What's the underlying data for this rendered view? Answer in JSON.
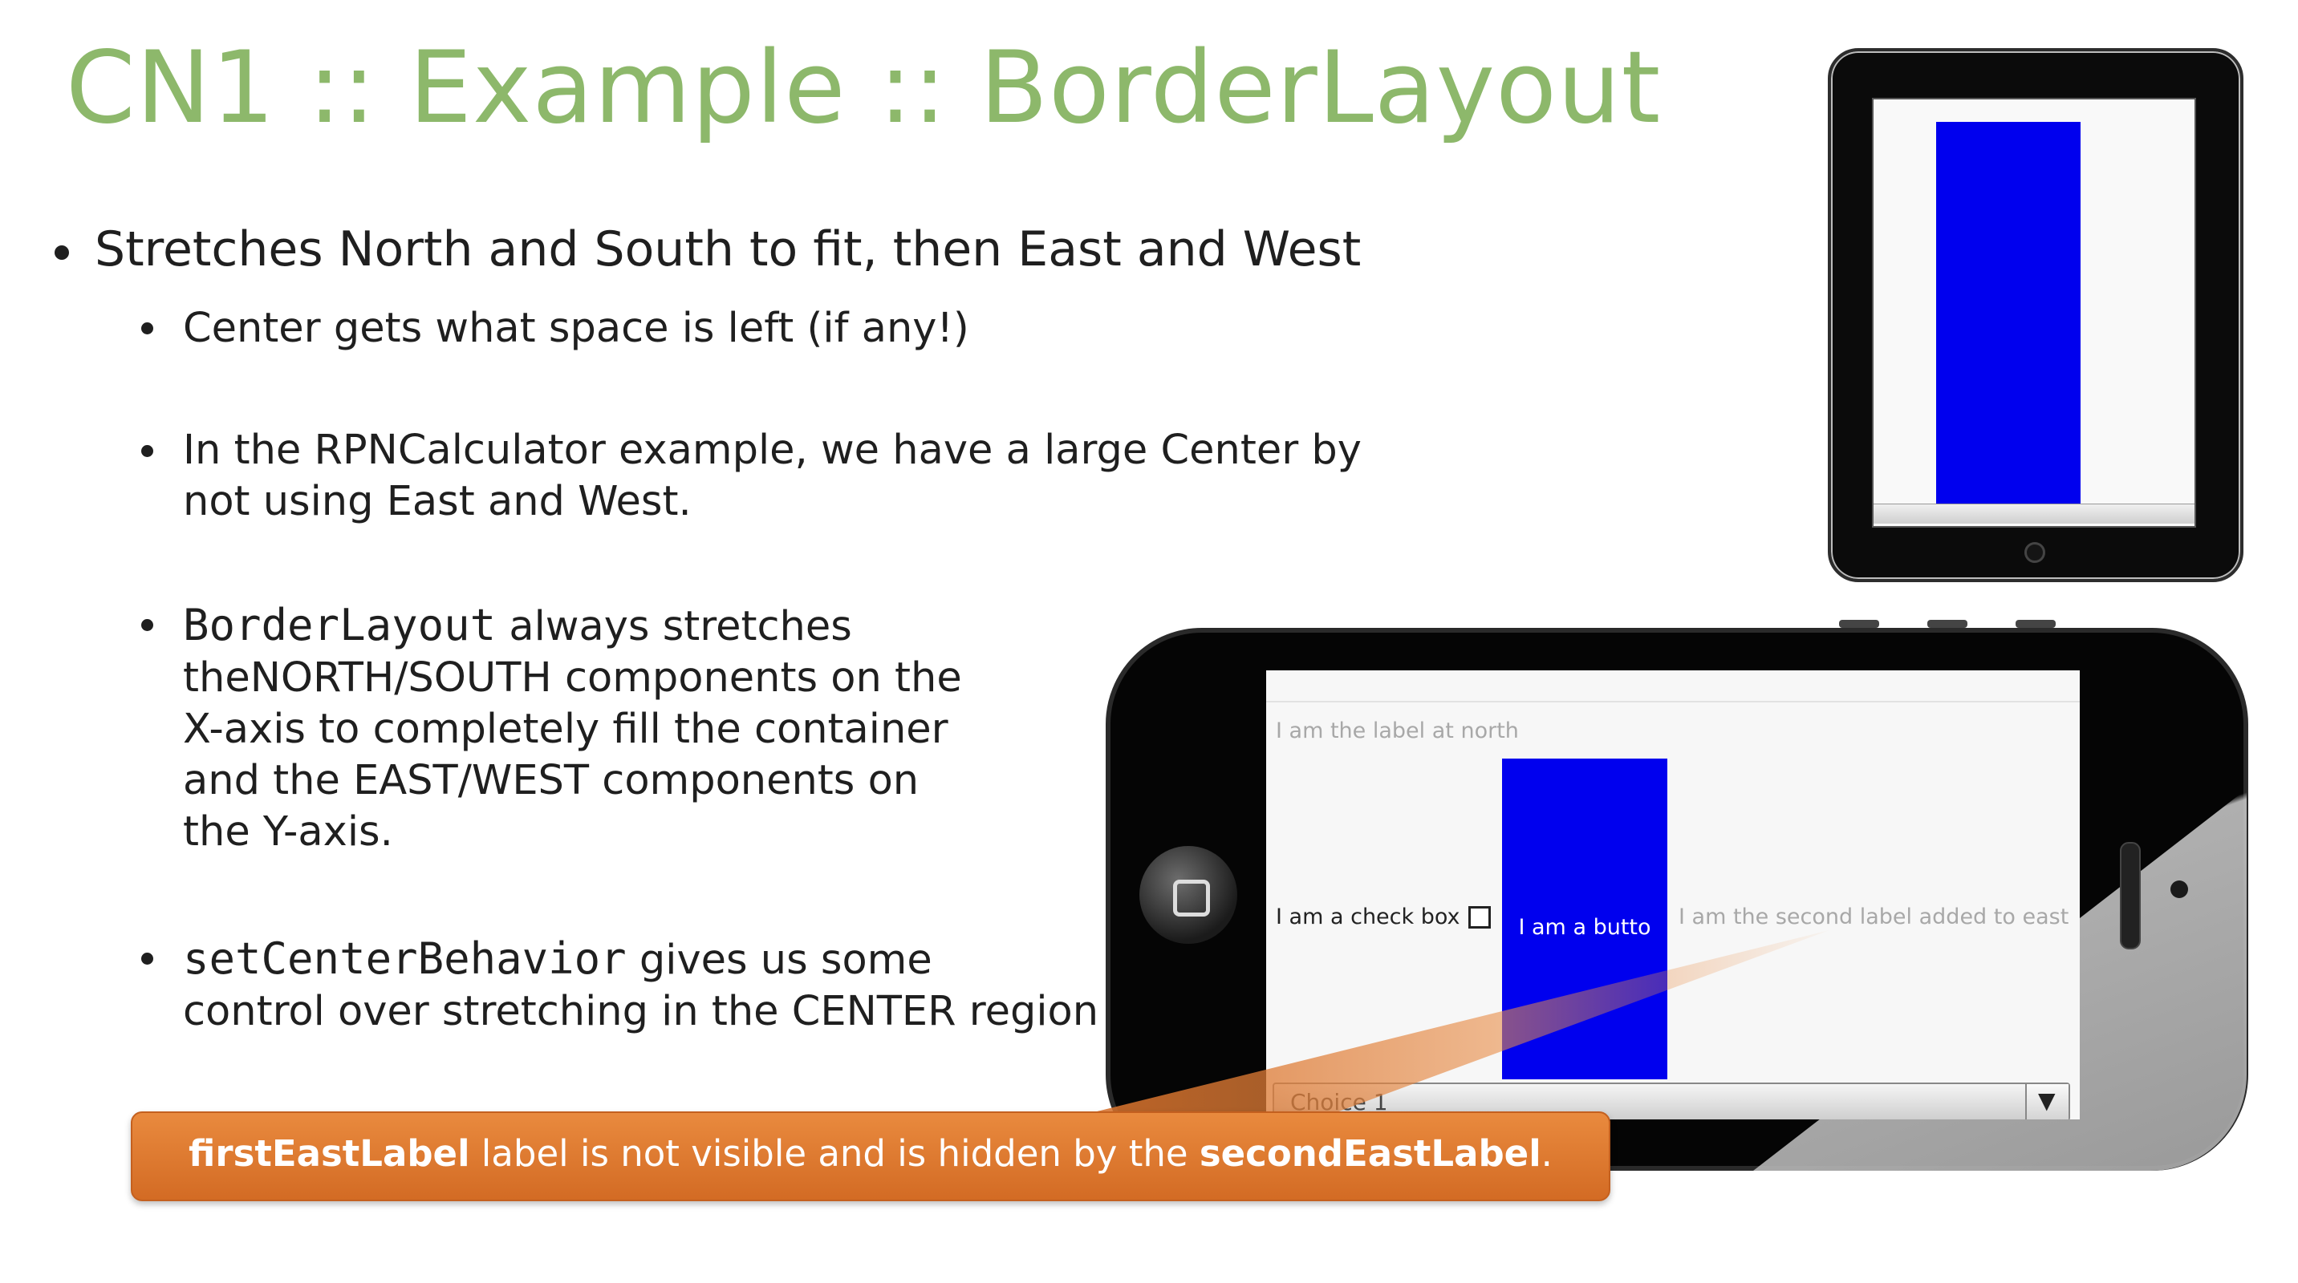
{
  "slide": {
    "title": "CN1 :: Example :: BorderLayout",
    "bullets": [
      {
        "text": "Stretches North and South to fit, then East and West"
      },
      {
        "text": "Center gets what space is left (if any!)"
      },
      {
        "line1": "In the RPNCalculator example, we have a large Center by",
        "line2": "not using East and West."
      },
      {
        "code": "BorderLayout",
        "line1_rest": " always stretches",
        "line2": "theNORTH/SOUTH components on  the",
        "line3": "X-axis to completely fill the container",
        "line4": "and the EAST/WEST components on",
        "line5": "the Y-axis."
      },
      {
        "code": "setCenterBehavior",
        "line1_rest": " gives us some",
        "line2": "control over stretching in the CENTER region"
      }
    ]
  },
  "phone_demo": {
    "north_label": "I am the label at north",
    "west_checkbox_label": "I am a check box",
    "checkbox_checked": false,
    "center_button_label": "I am a butto",
    "east_label": "I am the second label added to east",
    "south_combo_value": "Choice 1",
    "button_color": "#0000ee"
  },
  "callout": {
    "bold1": "firstEastLabel",
    "middle": " label is not visible and is hidden by the ",
    "bold2": "secondEastLabel",
    "end": "."
  },
  "colors": {
    "title": "#8db86b",
    "callout": "#e0782f"
  }
}
